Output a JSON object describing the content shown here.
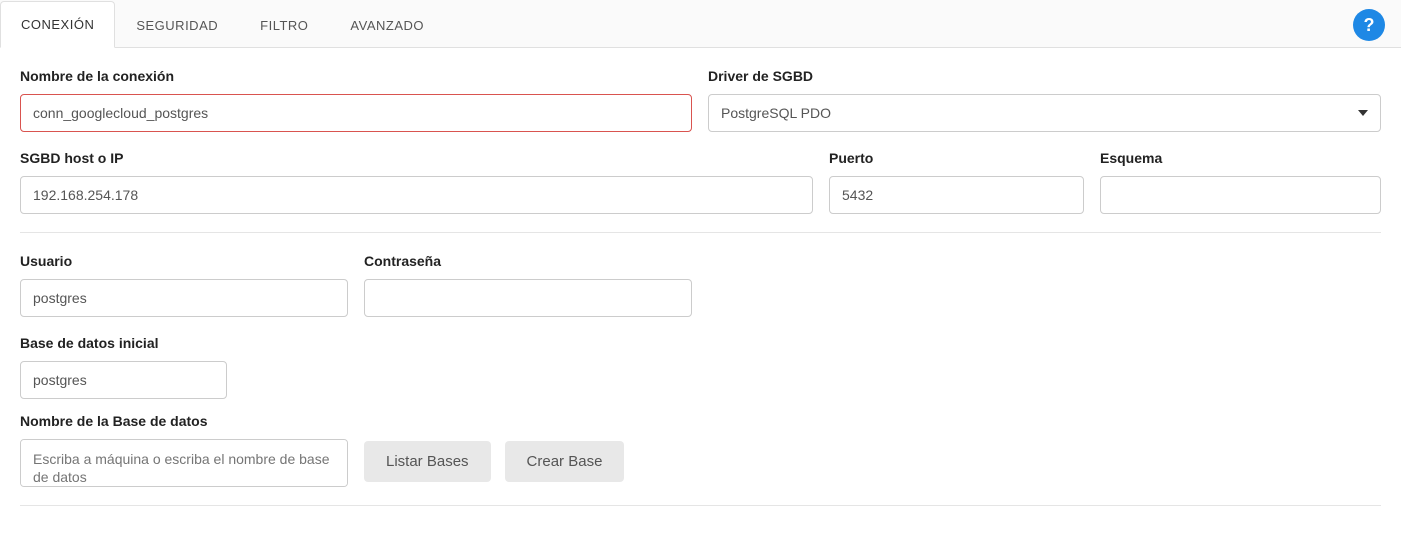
{
  "tabs": {
    "connection": "CONEXIÓN",
    "security": "SEGURIDAD",
    "filter": "FILTRO",
    "advanced": "AVANZADO"
  },
  "help_icon": "?",
  "fields": {
    "connection_name": {
      "label": "Nombre de la conexión",
      "value": "conn_googlecloud_postgres"
    },
    "driver": {
      "label": "Driver de SGBD",
      "value": "PostgreSQL PDO"
    },
    "host": {
      "label": "SGBD host o IP",
      "value": "192.168.254.178"
    },
    "port": {
      "label": "Puerto",
      "value": "5432"
    },
    "schema": {
      "label": "Esquema",
      "value": ""
    },
    "user": {
      "label": "Usuario",
      "value": "postgres"
    },
    "password": {
      "label": "Contraseña",
      "value": ""
    },
    "initial_db": {
      "label": "Base de datos inicial",
      "value": "postgres"
    },
    "db_name": {
      "label": "Nombre de la Base de datos",
      "placeholder": "Escriba a máquina o escriba el nombre de base de datos"
    }
  },
  "buttons": {
    "list_bases": "Listar Bases",
    "create_base": "Crear Base"
  }
}
